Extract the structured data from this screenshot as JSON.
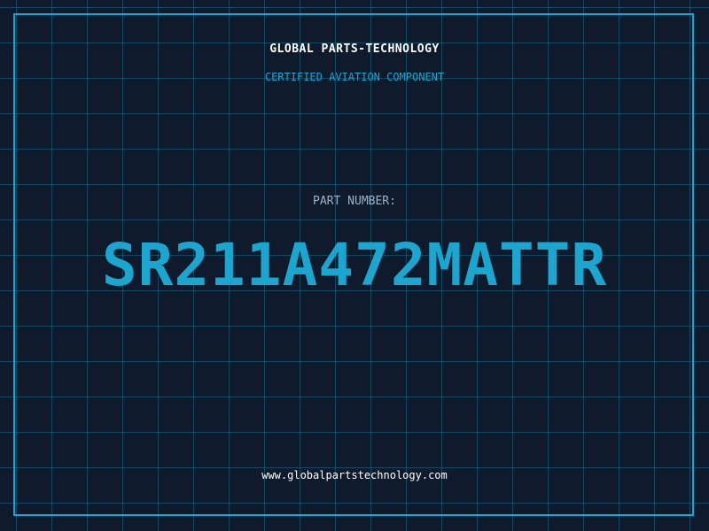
{
  "header": {
    "company": "GLOBAL PARTS-TECHNOLOGY",
    "subtitle": "CERTIFIED AVIATION COMPONENT"
  },
  "part": {
    "label": "PART NUMBER:",
    "number": "SR211A472MATTR"
  },
  "footer": {
    "website": "www.globalpartstechnology.com"
  },
  "colors": {
    "background": "#0f1a2c",
    "accent": "#1ba6cf",
    "grid": "#186c8a",
    "label": "#9fb3c8",
    "text": "#ffffff"
  }
}
